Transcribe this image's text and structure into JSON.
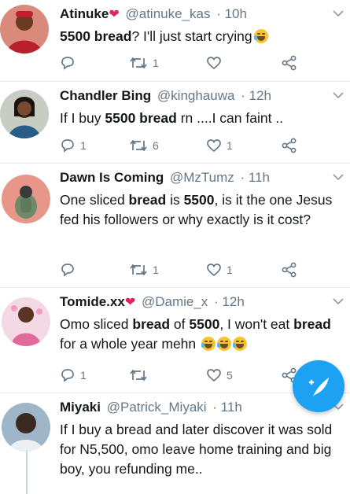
{
  "tweets": [
    {
      "name": "Atinuke",
      "heart": "❤",
      "handle": "@atinuke_kas",
      "time": "· 10h",
      "text": [
        {
          "b": "5500 bread"
        },
        {
          "t": "? I'll just start crying"
        }
      ],
      "emoji_count": 1,
      "reply_count": "",
      "retweet_count": "1",
      "like_count": ""
    },
    {
      "name": "Chandler Bing",
      "heart": "",
      "handle": "@kinghauwa",
      "time": "· 12h",
      "text": [
        {
          "t": "If I buy "
        },
        {
          "b": "5500 bread"
        },
        {
          "t": " rn ....I can faint .."
        }
      ],
      "emoji_count": 0,
      "reply_count": "1",
      "retweet_count": "6",
      "like_count": "1"
    },
    {
      "name": "Dawn Is Coming",
      "heart": "",
      "handle": "@MzTumz",
      "time": "· 11h",
      "text": [
        {
          "t": "One sliced "
        },
        {
          "b": "bread"
        },
        {
          "t": " is "
        },
        {
          "b": "5500"
        },
        {
          "t": ", is it the one Jesus fed his followers or why exactly is it cost?"
        }
      ],
      "emoji_count": 0,
      "reply_count": "",
      "retweet_count": "1",
      "like_count": "1"
    },
    {
      "name": "Tomide.xx",
      "heart": "❤",
      "handle": "@Damie_x",
      "time": "· 12h",
      "text": [
        {
          "t": "Omo sliced "
        },
        {
          "b": "bread"
        },
        {
          "t": " of "
        },
        {
          "b": "5500"
        },
        {
          "t": ", I won't eat "
        },
        {
          "b": "bread"
        },
        {
          "t": " for a whole year mehn "
        }
      ],
      "emoji_count": 3,
      "reply_count": "1",
      "retweet_count": "",
      "like_count": "5"
    },
    {
      "name": "Miyaki",
      "heart": "",
      "handle": "@Patrick_Miyaki",
      "time": "· 11h",
      "text": [
        {
          "t": "If I buy a bread and later discover it was sold for N5,500, omo leave home training and big boy, you refunding me.."
        }
      ],
      "emoji_count": 0,
      "reply_count": "",
      "retweet_count": "",
      "like_count": ""
    }
  ],
  "icons": {
    "reply": "reply-icon",
    "retweet": "retweet-icon",
    "like": "like-icon",
    "share": "share-icon",
    "more": "chevron-down-icon",
    "compose": "compose-tweet-icon"
  },
  "colors": {
    "accent": "#1da1f2",
    "heart": "#e0245e",
    "meta_text": "#657786",
    "divider": "#e6ecf0"
  }
}
